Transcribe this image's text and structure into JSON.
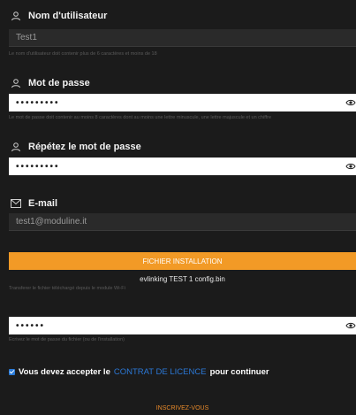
{
  "username": {
    "label": "Nom d'utilisateur",
    "value": "Test1",
    "hint": "Le nom d'utilisateur doit contenir plus de 6 caractères et moins de 18"
  },
  "password": {
    "label": "Mot de passe",
    "value": "•••••••••",
    "hint": "Le mot de passe doit contenir au moins 8 caractères dont au moins une lettre minuscule, une lettre majuscule et un chiffre"
  },
  "repeat_password": {
    "label": "Répétez le mot de passe",
    "value": "•••••••••"
  },
  "email": {
    "label": "E-mail",
    "value": "test1@moduline.it"
  },
  "install_file": {
    "button_label": "FICHIER INSTALLATION",
    "file_name": "evlinking TEST 1 config.bin",
    "hint": "Transferer le fichier téléchargé depuis le module Wi-Fi"
  },
  "file_password": {
    "value": "••••••",
    "hint": "Ecrivez le mot de passe du fichier (ou de l'installation)"
  },
  "terms": {
    "checked": true,
    "prefix": "Vous devez accepter le",
    "link": "CONTRAT DE LICENCE",
    "suffix": "pour continuer"
  },
  "submit_label": "INSCRIVEZ-VOUS",
  "colors": {
    "accent": "#f29a26",
    "link": "#2b78d6",
    "background": "#1b1b1b"
  }
}
